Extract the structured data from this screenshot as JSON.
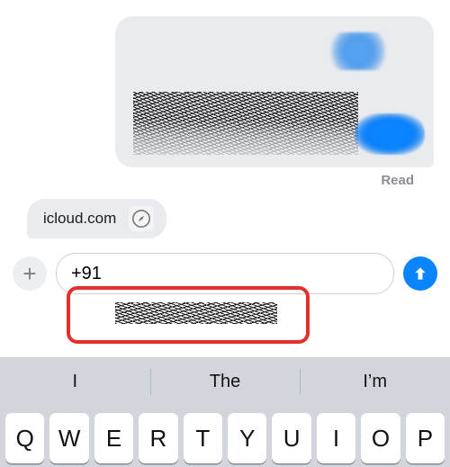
{
  "conversation": {
    "status_read": "Read"
  },
  "link_preview": {
    "domain": "icloud.com",
    "icon": "safari-compass-icon"
  },
  "composer": {
    "plus_label": "+",
    "input_value": "+91",
    "send_icon": "arrow-up-icon"
  },
  "keyboard": {
    "suggestions": [
      "I",
      "The",
      "I’m"
    ],
    "row1": [
      "Q",
      "W",
      "E",
      "R",
      "T",
      "Y",
      "U",
      "I",
      "O",
      "P"
    ]
  }
}
